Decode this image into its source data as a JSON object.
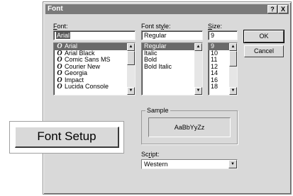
{
  "dialog": {
    "title": "Font",
    "help_label": "?",
    "close_label": "X"
  },
  "font": {
    "label_pre": "",
    "label_key": "F",
    "label_post": "ont:",
    "value": "Arial",
    "items": [
      "Arial",
      "Arial Black",
      "Comic Sans MS",
      "Courier New",
      "Georgia",
      "Impact",
      "Lucida Console"
    ]
  },
  "style": {
    "label_pre": "Font st",
    "label_key": "y",
    "label_post": "le:",
    "value": "Regular",
    "items": [
      "Regular",
      "Italic",
      "Bold",
      "Bold Italic"
    ]
  },
  "size": {
    "label_pre": "",
    "label_key": "S",
    "label_post": "ize:",
    "value": "9",
    "items": [
      "9",
      "10",
      "11",
      "12",
      "14",
      "16",
      "18"
    ]
  },
  "buttons": {
    "ok": "OK",
    "cancel": "Cancel"
  },
  "sample": {
    "label": "Sample",
    "text": "AaBbYyZz"
  },
  "script": {
    "label_pre": "Sc",
    "label_key": "r",
    "label_post": "ipt:",
    "value": "Western"
  },
  "callout": {
    "label": "Font Setup"
  },
  "icons": {
    "arrow_up": "▲",
    "arrow_down": "▼",
    "font_glyph": "O",
    "font_glyph_selected": "O"
  }
}
